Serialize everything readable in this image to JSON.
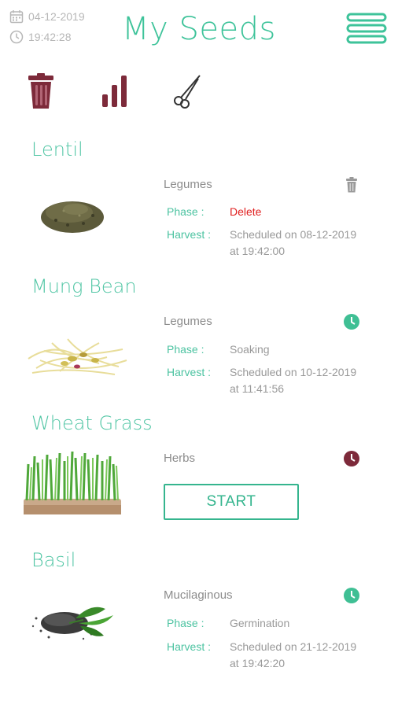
{
  "app": {
    "title": "My Seeds",
    "date": "04-12-2019",
    "time": "19:42:28",
    "accent_color": "#3ec39a",
    "maroon_color": "#7d2a3a"
  },
  "toolbar": {
    "icons": [
      "trash-icon",
      "stats-icon",
      "scissors-icon"
    ]
  },
  "labels": {
    "phase": "Phase :",
    "harvest": "Harvest :"
  },
  "seeds": [
    {
      "name": "Lentil",
      "category": "Legumes",
      "status_icon": "trash-icon",
      "phase": "Delete",
      "harvest_line1": "Scheduled on 08-12-2019",
      "harvest_line2": "at 19:42:00"
    },
    {
      "name": "Mung Bean",
      "category": "Legumes",
      "status_icon": "clock-icon",
      "phase": "Soaking",
      "harvest_line1": "Scheduled on 10-12-2019",
      "harvest_line2": "at 11:41:56"
    },
    {
      "name": "Wheat Grass",
      "category": "Herbs",
      "status_icon": "clock-icon",
      "start_label": "START"
    },
    {
      "name": "Basil",
      "category": "Mucilaginous",
      "status_icon": "clock-icon",
      "phase": "Germination",
      "harvest_line1": "Scheduled on 21-12-2019",
      "harvest_line2": "at 19:42:20"
    }
  ]
}
